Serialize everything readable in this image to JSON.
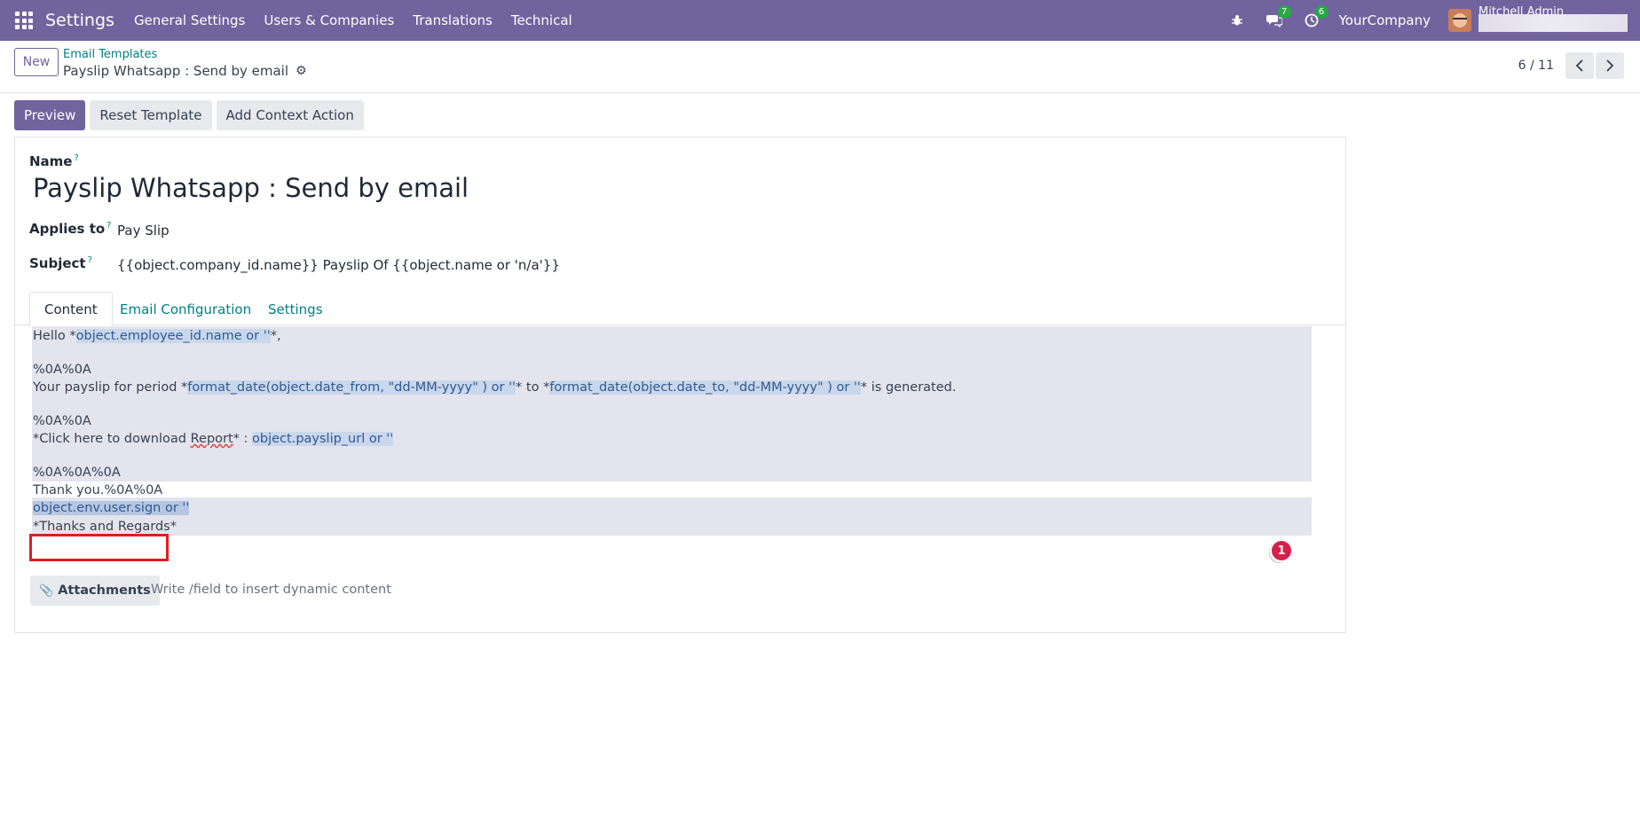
{
  "navbar": {
    "brand": "Settings",
    "menu": [
      "General Settings",
      "Users & Companies",
      "Translations",
      "Technical"
    ],
    "chat_badge": "7",
    "activity_badge": "6",
    "company": "YourCompany",
    "user": "Mitchell Admin"
  },
  "control": {
    "new_label": "New",
    "breadcrumb_parent": "Email Templates",
    "breadcrumb_current": "Payslip Whatsapp : Send by email",
    "pager": "6 / 11"
  },
  "actions": {
    "preview": "Preview",
    "reset": "Reset Template",
    "context": "Add Context Action"
  },
  "form": {
    "name_label": "Name",
    "name_value": "Payslip Whatsapp : Send by email",
    "applies_label": "Applies to",
    "applies_value": "Pay Slip",
    "subject_label": "Subject",
    "subject_value": "{{object.company_id.name}} Payslip Of {{object.name or 'n/a'}}",
    "help_mark": "?"
  },
  "tabs": [
    "Content",
    "Email Configuration",
    "Settings"
  ],
  "content": {
    "l1_a": "Hello *",
    "l1_dyn": "object.employee_id.name or ''",
    "l1_b": "*,",
    "l2": "%0A%0A",
    "l3_a": "Your payslip for period *",
    "l3_dyn1": "format_date(object.date_from, \"dd-MM-yyyy\" ) or ''",
    "l3_b": "* to *",
    "l3_dyn2": "format_date(object.date_to, \"dd-MM-yyyy\" ) or ''",
    "l3_c": "* is generated.",
    "l4": "%0A%0A",
    "l5_a": "*Click here to download ",
    "l5_report": "Report",
    "l5_b": "* : ",
    "l5_dyn": "object.payslip_url or ''",
    "l6": "%0A%0A%0A",
    "l7": "Thank you.%0A%0A",
    "l8_dyn": "object.env.user.sign or ''",
    "l9": "*Thanks and Regards*",
    "marker": "1"
  },
  "attachments": {
    "label": "Attachments",
    "placeholder": "Write /field to insert dynamic content"
  }
}
